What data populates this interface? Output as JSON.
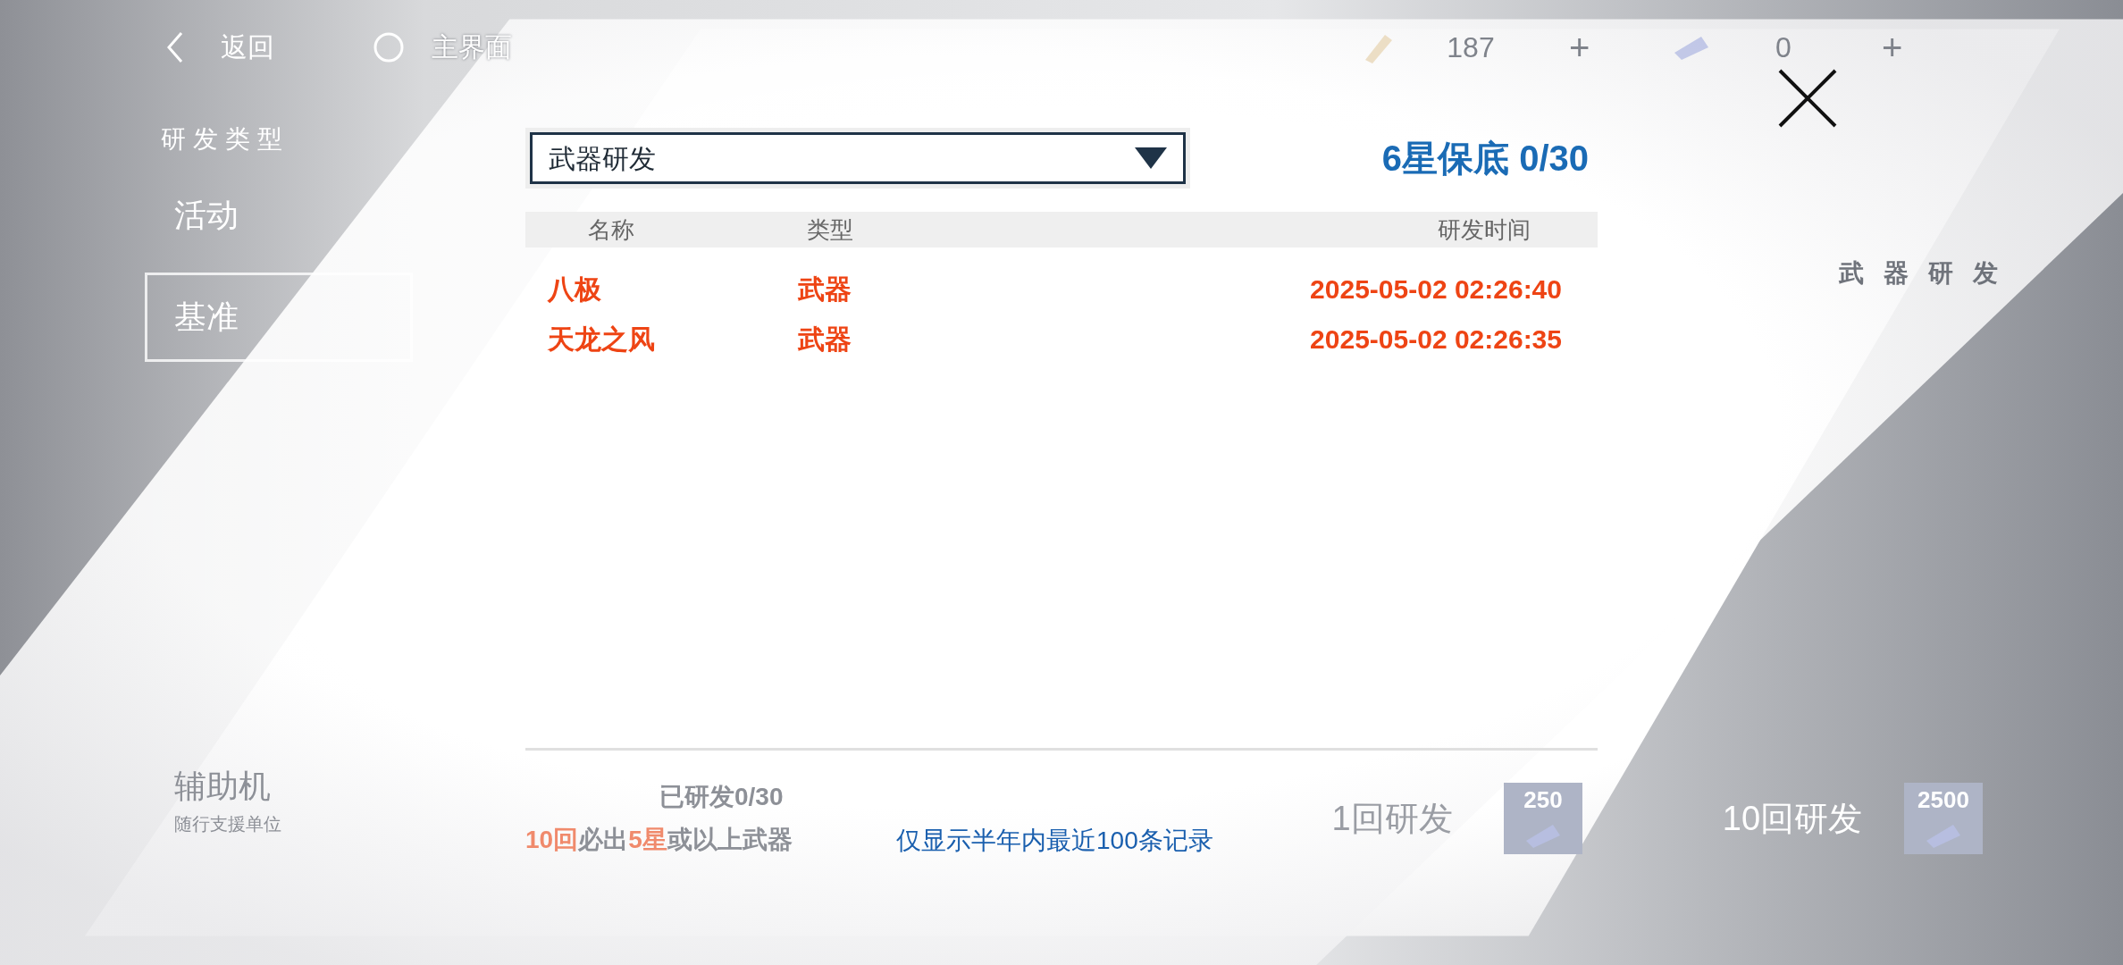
{
  "top_bar": {
    "back": "返回",
    "home": "主界面",
    "currencies": [
      {
        "amount": "187",
        "add": "+"
      },
      {
        "amount": "0",
        "add": "+"
      }
    ]
  },
  "sidebar": {
    "title": "研发类型",
    "items": [
      {
        "label": "活动",
        "selected": false
      },
      {
        "label": "基准",
        "selected": true
      },
      {
        "label": "辅助机",
        "subtitle": "随行支援单位",
        "selected": false
      }
    ]
  },
  "banner": {
    "title": "武器研发"
  },
  "dialog": {
    "pool_select": {
      "value": "武器研发"
    },
    "pity": "6星保底 0/30",
    "table": {
      "columns": [
        "名称",
        "类型",
        "研发时间"
      ],
      "rows": [
        {
          "name": "八极",
          "type": "武器",
          "time": "2025-05-02 02:26:40"
        },
        {
          "name": "天龙之风",
          "type": "武器",
          "time": "2025-05-02 02:26:35"
        }
      ]
    },
    "notice": "仅显示半年内最近100条记录"
  },
  "draw_panel": {
    "progress": "已研发0/30",
    "guarantee": [
      {
        "text": "10回",
        "highlight": true
      },
      {
        "text": "必出",
        "highlight": false
      },
      {
        "text": "5星",
        "highlight": true
      },
      {
        "text": "或以上武器",
        "highlight": false
      }
    ],
    "buttons": [
      {
        "label": "1回研发",
        "cost": "250"
      },
      {
        "label": "10回研发",
        "cost": "2500"
      }
    ]
  }
}
